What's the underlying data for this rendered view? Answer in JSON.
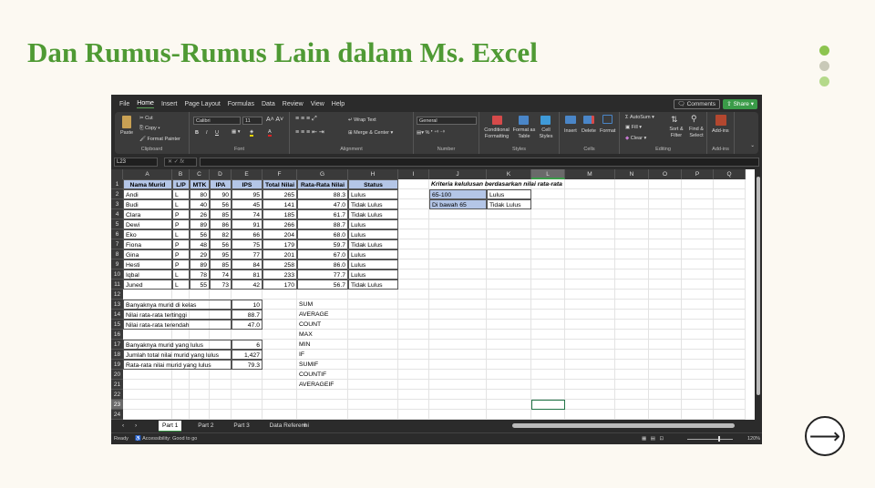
{
  "slide": {
    "title": "Dan Rumus-Rumus Lain dalam Ms. Excel",
    "dot_colors": [
      "#8dc44f",
      "#c9c9b8",
      "#b4d98a"
    ],
    "next_icon": "arrow-right-icon"
  },
  "menu": [
    "File",
    "Home",
    "Insert",
    "Page Layout",
    "Formulas",
    "Data",
    "Review",
    "View",
    "Help"
  ],
  "menu_active": "Home",
  "comments_label": "Comments",
  "share_label": "Share",
  "ribbon": {
    "clipboard": {
      "label": "Clipboard",
      "paste": "Paste",
      "cut": "Cut",
      "copy": "Copy",
      "format_painter": "Format Painter"
    },
    "font": {
      "label": "Font",
      "name": "Calibri",
      "size": "11",
      "bold": "B",
      "italic": "I",
      "underline": "U"
    },
    "alignment": {
      "label": "Alignment",
      "wrap": "Wrap Text",
      "merge": "Merge & Center"
    },
    "number": {
      "label": "Number",
      "format": "General"
    },
    "styles": {
      "label": "Styles",
      "conditional": "Conditional Formatting",
      "table": "Format as Table",
      "cell": "Cell Styles"
    },
    "cells": {
      "label": "Cells",
      "insert": "Insert",
      "delete": "Delete",
      "format": "Format"
    },
    "editing": {
      "label": "Editing",
      "autosum": "AutoSum",
      "fill": "Fill",
      "clear": "Clear",
      "sort": "Sort & Filter",
      "find": "Find & Select"
    },
    "addins": {
      "label": "Add-ins",
      "addins": "Add-ins"
    }
  },
  "formula_bar": {
    "name_box": "L23",
    "fx": "fx",
    "value": ""
  },
  "columns": [
    "A",
    "B",
    "C",
    "D",
    "E",
    "F",
    "G",
    "H",
    "I",
    "J",
    "K",
    "L",
    "M",
    "N",
    "O",
    "P",
    "Q"
  ],
  "selected_column": "L",
  "selected_row": 23,
  "header_row": [
    "Nama Murid",
    "L/P",
    "MTK",
    "IPA",
    "IPS",
    "Total Nilai",
    "Rata-Rata Nilai",
    "Status"
  ],
  "students": [
    [
      "Andi",
      "L",
      "80",
      "90",
      "95",
      "265",
      "88.3",
      "Lulus"
    ],
    [
      "Budi",
      "L",
      "40",
      "56",
      "45",
      "141",
      "47.0",
      "Tidak Lulus"
    ],
    [
      "Clara",
      "P",
      "26",
      "85",
      "74",
      "185",
      "61.7",
      "Tidak Lulus"
    ],
    [
      "Dewi",
      "P",
      "89",
      "86",
      "91",
      "266",
      "88.7",
      "Lulus"
    ],
    [
      "Eko",
      "L",
      "56",
      "82",
      "66",
      "204",
      "68.0",
      "Lulus"
    ],
    [
      "Fiona",
      "P",
      "48",
      "56",
      "75",
      "179",
      "59.7",
      "Tidak Lulus"
    ],
    [
      "Gina",
      "P",
      "29",
      "95",
      "77",
      "201",
      "67.0",
      "Lulus"
    ],
    [
      "Hesti",
      "P",
      "89",
      "85",
      "84",
      "258",
      "86.0",
      "Lulus"
    ],
    [
      "Iqbal",
      "L",
      "78",
      "74",
      "81",
      "233",
      "77.7",
      "Lulus"
    ],
    [
      "Juned",
      "L",
      "55",
      "73",
      "42",
      "170",
      "56.7",
      "Tidak Lulus"
    ]
  ],
  "summary": [
    {
      "row": 13,
      "label": "Banyaknya murid di kelas",
      "value": "10"
    },
    {
      "row": 14,
      "label": "Nilai rata-rata tertinggi",
      "value": "88.7"
    },
    {
      "row": 15,
      "label": "Nilai rata-rata terendah",
      "value": "47.0"
    },
    {
      "row": 17,
      "label": "Banyaknya murid yang lulus",
      "value": "6"
    },
    {
      "row": 18,
      "label": "Jumlah total nilai murid yang lulus",
      "value": "1,427"
    },
    {
      "row": 19,
      "label": "Rata-rata nilai murid yang lulus",
      "value": "79.3"
    }
  ],
  "functions": [
    "SUM",
    "AVERAGE",
    "COUNT",
    "MAX",
    "MIN",
    "IF",
    "SUMIF",
    "COUNTIF",
    "AVERAGEIF"
  ],
  "criteria": {
    "title": "Kriteria kelulusan berdasarkan nilai rata-rata",
    "rows": [
      [
        "65-100",
        "Lulus"
      ],
      [
        "Di bawah 65",
        "Tidak Lulus"
      ]
    ]
  },
  "sheet_tabs": [
    "Part 1",
    "Part 2",
    "Part 3",
    "Data Referensi"
  ],
  "active_tab": "Part 1",
  "status": {
    "ready": "Ready",
    "accessibility": "Accessibility: Good to go",
    "zoom": "120%"
  },
  "colors": {
    "header_fill": "#b4c6e7",
    "title_green": "#4f9a34",
    "share_green": "#3a9b48"
  }
}
